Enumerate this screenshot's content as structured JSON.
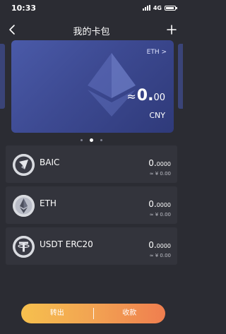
{
  "status_bar": {
    "time": "10:33",
    "network": "4G"
  },
  "nav": {
    "title": "我的卡包"
  },
  "card": {
    "coin_link": "ETH >",
    "approx": "≈",
    "balance_main": "0.",
    "balance_dec": "00",
    "currency": "CNY",
    "color": "#4a5aa8"
  },
  "pager": {
    "count": 3,
    "active": 1
  },
  "tokens": [
    {
      "name": "BAIC",
      "amount_main": "0.",
      "amount_dec": "0000",
      "fiat": "≈ ¥ 0.00",
      "icon": "baic-icon"
    },
    {
      "name": "ETH",
      "amount_main": "0.",
      "amount_dec": "0000",
      "fiat": "≈ ¥ 0.00",
      "icon": "eth-icon"
    },
    {
      "name": "USDT ERC20",
      "amount_main": "0.",
      "amount_dec": "0000",
      "fiat": "≈ ¥ 0.00",
      "icon": "usdt-icon"
    }
  ],
  "actions": {
    "transfer_out": "转出",
    "receive": "收款"
  },
  "colors": {
    "background": "#2b2c33",
    "accent_start": "#f6c04e",
    "accent_end": "#ef7e4f"
  }
}
